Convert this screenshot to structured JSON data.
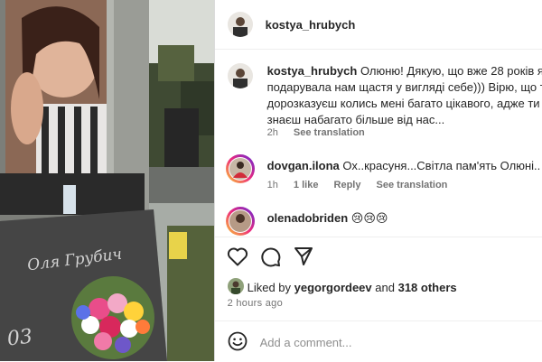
{
  "post": {
    "author": "kostya_hrubych"
  },
  "comments": [
    {
      "username": "kostya_hrubych",
      "lines": [
        "Олюню! Дякую, що вже 28 років як",
        "подарувала нам щастя у вигляді себе))) Вірю, що ти ш",
        "дорозказуєш колись мені багато цікавого, адже ти тепе",
        "знаєш набагато більше від нас..."
      ],
      "time": "2h",
      "translate": "See translation"
    },
    {
      "username": "dovgan.ilona",
      "text": "Ох..красуня...Світла пам'ять Олюні..",
      "time": "1h",
      "likes": "1 like",
      "reply": "Reply",
      "translate": "See translation"
    },
    {
      "username": "olenadobriden",
      "text": "😢😢😢"
    }
  ],
  "actions": {
    "like_icon": "heart-icon",
    "comment_icon": "comment-icon",
    "share_icon": "send-icon"
  },
  "liked_by": {
    "prefix": "Liked by",
    "user": "yegorgordeev",
    "and": "and",
    "others": "318 others"
  },
  "posted_ago": "2 hours ago",
  "add_comment": {
    "placeholder": "Add a comment...",
    "emoji_icon": "emoji-icon"
  },
  "photo": {
    "inscription": "Оля Грубич",
    "date_fragment": "03"
  }
}
